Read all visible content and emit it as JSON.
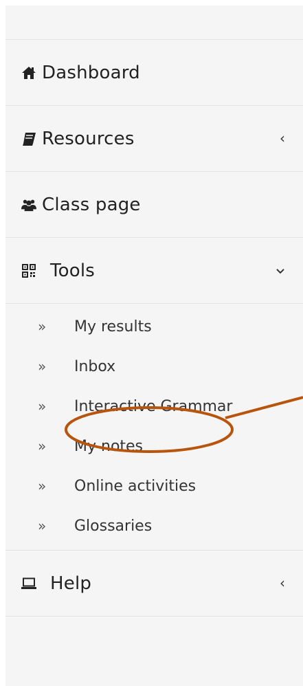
{
  "menu": {
    "dashboard": "Dashboard",
    "resources": "Resources",
    "class_page": "Class page",
    "tools": "Tools",
    "help": "Help"
  },
  "chevrons": {
    "collapsed": "‹",
    "expanded": "⌄"
  },
  "tools_submenu": {
    "bullet": "»",
    "items": [
      "My results",
      "Inbox",
      "Interactive Grammar",
      "My notes",
      "Online activities",
      "Glossaries"
    ]
  },
  "colors": {
    "sidebar_bg": "#f5f5f5",
    "divider": "#e2e2e2",
    "annotation": "#b8550d"
  },
  "icons": {
    "dashboard": "home-icon",
    "resources": "book-icon",
    "class_page": "users-icon",
    "tools": "qrcode-icon",
    "help": "laptop-icon"
  }
}
